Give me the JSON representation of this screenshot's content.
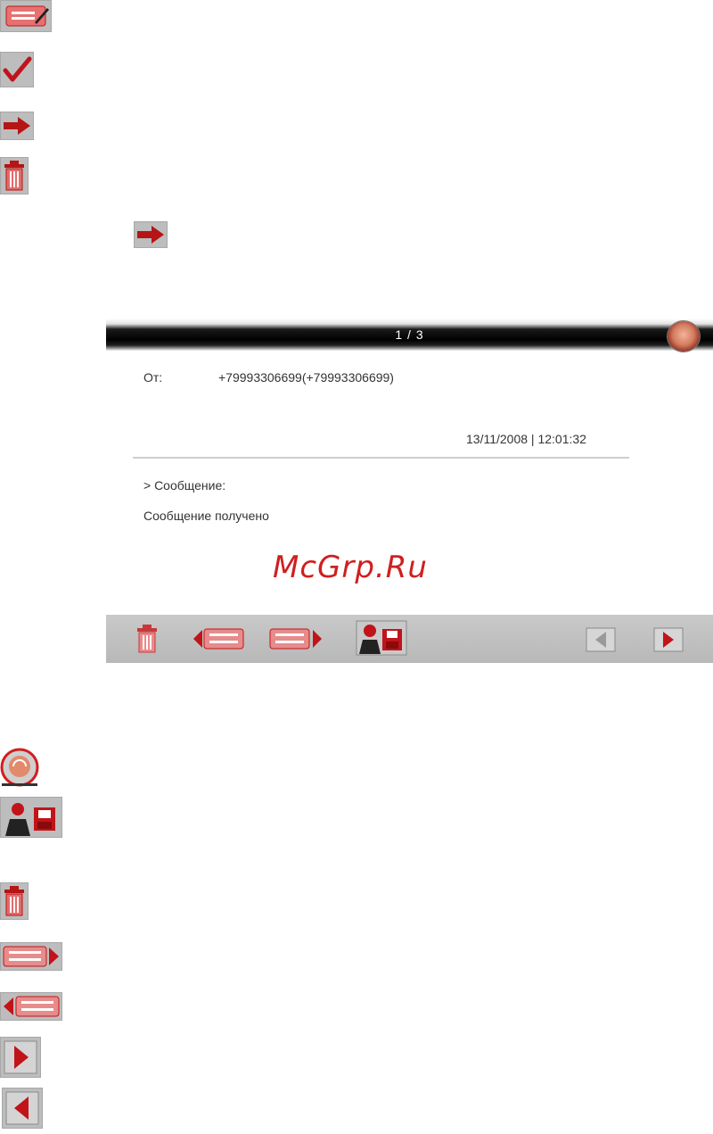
{
  "legend_top": {
    "items": [
      {
        "icon": "compose-icon"
      },
      {
        "icon": "check-icon"
      },
      {
        "icon": "forward-arrow-icon"
      },
      {
        "icon": "trash-icon"
      }
    ],
    "inline_icon": "forward-arrow-icon"
  },
  "screen": {
    "title": "1 / 3",
    "from_label": "От:",
    "from_value": "+79993306699(+79993306699)",
    "datetime": "13/11/2008 | 12:01:32",
    "message_header": "> Сообщение:",
    "message_body": "Сообщение получено",
    "toolbar": {
      "buttons": [
        "trash-icon",
        "previous-message-icon",
        "next-message-icon",
        "save-contact-icon",
        "page-prev-icon",
        "page-next-icon"
      ]
    }
  },
  "watermark": "McGrp.Ru",
  "legend_bottom": {
    "items": [
      {
        "icon": "home-icon"
      },
      {
        "icon": "save-contact-icon"
      },
      {
        "icon": "trash-icon"
      },
      {
        "icon": "next-message-icon"
      },
      {
        "icon": "previous-message-icon"
      },
      {
        "icon": "page-next-icon"
      },
      {
        "icon": "page-prev-icon"
      }
    ]
  },
  "colors": {
    "accent": "#c0141a",
    "tile": "#bdbdbd",
    "titlebar": "#000000"
  }
}
